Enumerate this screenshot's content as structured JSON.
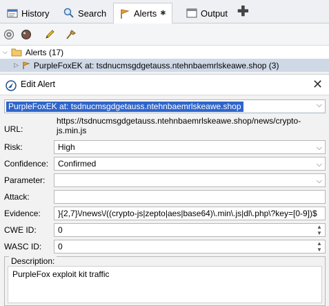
{
  "tabs": [
    {
      "label": "History",
      "icon": "history-icon"
    },
    {
      "label": "Search",
      "icon": "search-icon"
    },
    {
      "label": "Alerts",
      "icon": "flag-icon"
    },
    {
      "label": "Output",
      "icon": "output-icon"
    }
  ],
  "tree": {
    "root_label": "Alerts (17)",
    "selected_label": "PurpleFoxEK at: tsdnucmsgdgetauss.ntehnbaemrlskeawe.shop (3)"
  },
  "dialog": {
    "title": "Edit Alert",
    "alert_name": "PurpleFoxEK at: tsdnucmsgdgetauss.ntehnbaemrlskeawe.shop",
    "url_label": "URL:",
    "url_value": "https://tsdnucmsgdgetauss.ntehnbaemrlskeawe.shop/news/crypto-js.min.js",
    "risk_label": "Risk:",
    "risk_value": "High",
    "confidence_label": "Confidence:",
    "confidence_value": "Confirmed",
    "parameter_label": "Parameter:",
    "parameter_value": "",
    "attack_label": "Attack:",
    "attack_value": "",
    "evidence_label": "Evidence:",
    "evidence_value": "}{2,7}\\/news\\/((crypto-js|zepto|aes|base64)\\.min\\.js|dl\\.php\\?key=[0-9])$",
    "cwe_label": "CWE ID:",
    "cwe_value": "0",
    "wasc_label": "WASC ID:",
    "wasc_value": "0",
    "description_label": "Description:",
    "description_value": "PurpleFox exploit kit traffic"
  },
  "colors": {
    "selection": "#2f65ca",
    "tree_selected": "#cfd9e6",
    "flag": "#e8a13a"
  }
}
